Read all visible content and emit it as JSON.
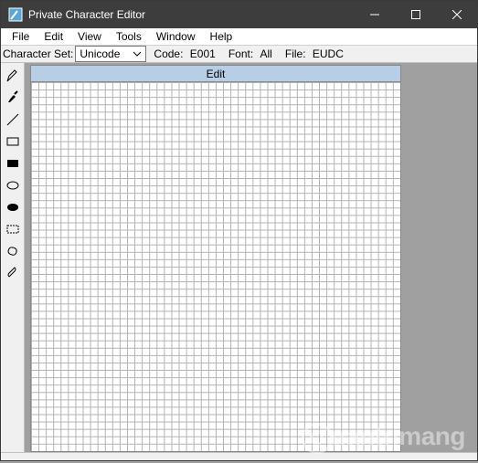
{
  "window": {
    "title": "Private Character Editor"
  },
  "menu": {
    "items": [
      "File",
      "Edit",
      "View",
      "Tools",
      "Window",
      "Help"
    ]
  },
  "infobar": {
    "charset_label": "Character Set:",
    "charset_value": "Unicode",
    "code_label": "Code:",
    "code_value": "E001",
    "font_label": "Font:",
    "font_value": "All",
    "file_label": "File:",
    "file_value": "EUDC"
  },
  "canvas": {
    "header": "Edit",
    "grid_size": 50
  },
  "tools": [
    {
      "name": "pencil"
    },
    {
      "name": "brush"
    },
    {
      "name": "line"
    },
    {
      "name": "rect-outline"
    },
    {
      "name": "rect-fill"
    },
    {
      "name": "ellipse-outline"
    },
    {
      "name": "ellipse-fill"
    },
    {
      "name": "rect-select"
    },
    {
      "name": "freeform-select"
    },
    {
      "name": "eraser"
    }
  ],
  "watermark": "uantrimang"
}
